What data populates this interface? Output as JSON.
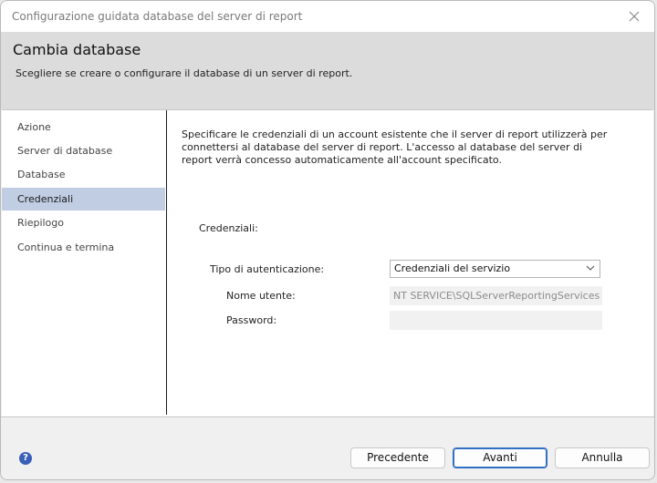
{
  "window": {
    "title": "Configurazione guidata database del server di report"
  },
  "header": {
    "title": "Cambia database",
    "subtitle": "Scegliere se creare o configurare il database di un server di report."
  },
  "nav": {
    "items": [
      {
        "label": "Azione"
      },
      {
        "label": "Server di database"
      },
      {
        "label": "Database"
      },
      {
        "label": "Credenziali",
        "selected": true
      },
      {
        "label": "Riepilogo"
      },
      {
        "label": "Continua e termina"
      }
    ]
  },
  "main": {
    "description": "Specificare le credenziali di un account esistente che il server di report utilizzerà per connettersi al database del server di report. L'accesso al database del server di report verrà concesso automaticamente all'account specificato.",
    "credentials_title": "Credenziali:",
    "auth_type_label": "Tipo di autenticazione:",
    "auth_type_value": "Credenziali del servizio",
    "username_label": "Nome utente:",
    "username_value": "NT SERVICE\\SQLServerReportingServices",
    "password_label": "Password:",
    "password_value": ""
  },
  "footer": {
    "back_label": "Precedente",
    "next_label": "Avanti",
    "cancel_label": "Annulla"
  }
}
